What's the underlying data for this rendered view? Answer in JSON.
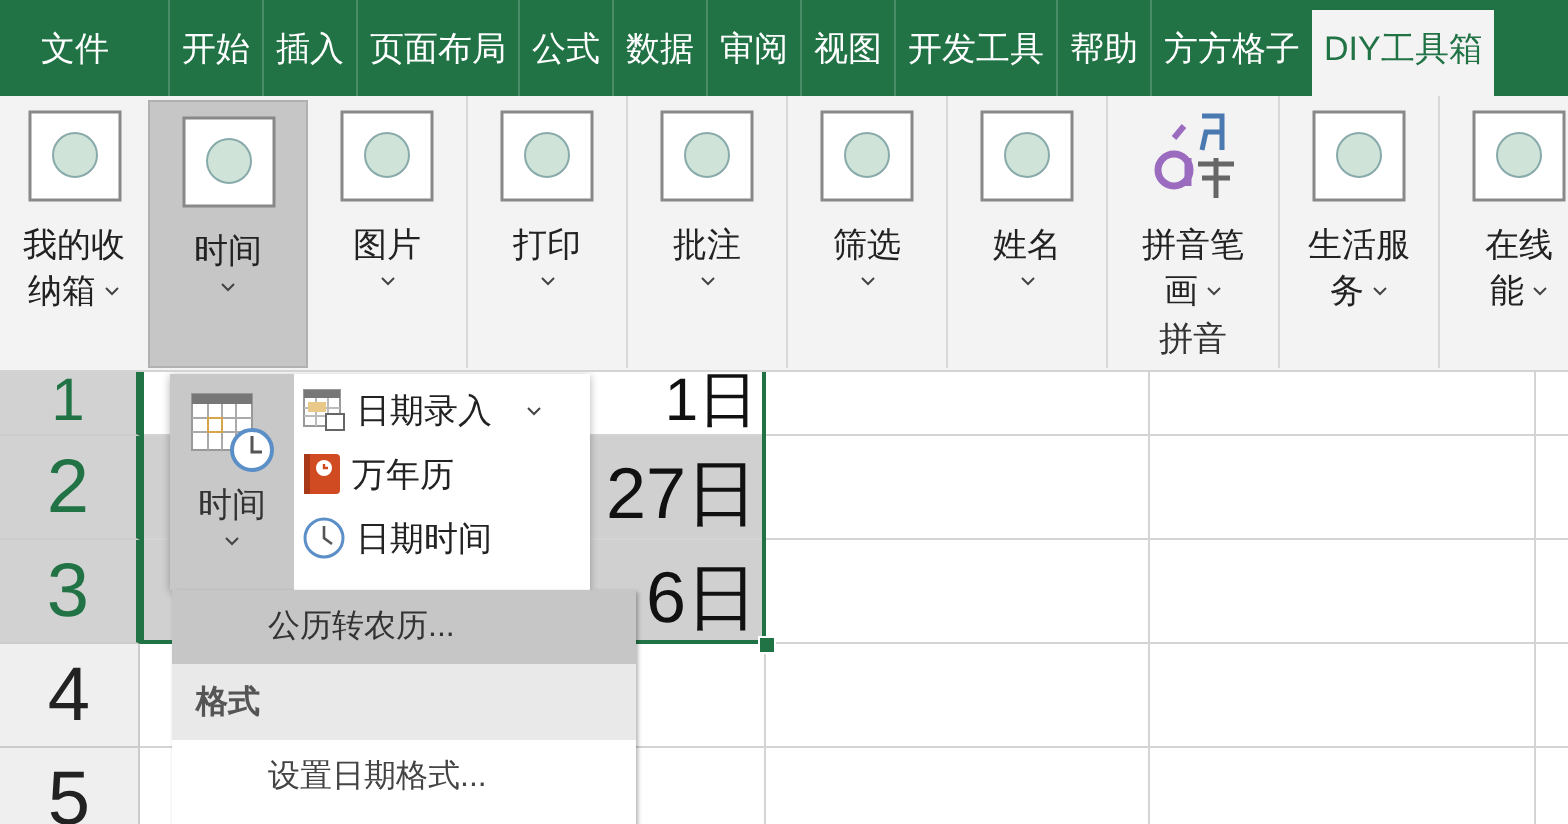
{
  "tabs": [
    {
      "label": "文件",
      "selected": false
    },
    {
      "label": "开始",
      "selected": false
    },
    {
      "label": "插入",
      "selected": false
    },
    {
      "label": "页面布局",
      "selected": false
    },
    {
      "label": "公式",
      "selected": false
    },
    {
      "label": "数据",
      "selected": false
    },
    {
      "label": "审阅",
      "selected": false
    },
    {
      "label": "视图",
      "selected": false
    },
    {
      "label": "开发工具",
      "selected": false
    },
    {
      "label": "帮助",
      "selected": false
    },
    {
      "label": "方方格子",
      "selected": false
    },
    {
      "label": "DIY工具箱",
      "selected": true
    }
  ],
  "ribbon": {
    "buttons": [
      {
        "kind": "box",
        "lines": [
          "我的收",
          "纳箱"
        ],
        "caret": true,
        "pressed": false
      },
      {
        "kind": "box",
        "lines": [
          "时间"
        ],
        "caret": true,
        "pressed": true
      },
      {
        "kind": "box",
        "lines": [
          "图片"
        ],
        "caret": true,
        "pressed": false
      },
      {
        "kind": "box",
        "lines": [
          "打印"
        ],
        "caret": true,
        "pressed": false
      },
      {
        "kind": "box",
        "lines": [
          "批注"
        ],
        "caret": true,
        "pressed": false
      },
      {
        "kind": "box",
        "lines": [
          "筛选"
        ],
        "caret": true,
        "pressed": false
      },
      {
        "kind": "box",
        "lines": [
          "姓名"
        ],
        "caret": true,
        "pressed": false
      },
      {
        "kind": "pinyin",
        "lines": [
          "拼音笔",
          "画"
        ],
        "caret": true,
        "pressed": false,
        "group_label": "拼音"
      },
      {
        "kind": "box",
        "lines": [
          "生活服",
          "务"
        ],
        "caret": true,
        "pressed": false
      },
      {
        "kind": "box",
        "lines": [
          "在线",
          "能"
        ],
        "caret": true,
        "pressed": false
      }
    ]
  },
  "sheet": {
    "rows": [
      {
        "header": "1",
        "selected": true,
        "cell": "1日"
      },
      {
        "header": "2",
        "selected": true,
        "cell": "27日"
      },
      {
        "header": "3",
        "selected": true,
        "cell": "6日"
      },
      {
        "header": "4",
        "selected": false
      },
      {
        "header": "5",
        "selected": false
      }
    ]
  },
  "time_popup": {
    "button": {
      "label": "时间",
      "pressed": true,
      "caret": true
    },
    "items": [
      {
        "kind": "calendar",
        "label": "日期录入",
        "caret": true
      },
      {
        "kind": "almanac",
        "label": "万年历",
        "caret": false
      },
      {
        "kind": "clock",
        "label": "日期时间",
        "caret": false
      }
    ]
  },
  "menu": [
    {
      "kind": "item",
      "label": "公历转农历...",
      "selected": true
    },
    {
      "kind": "header",
      "label": "格式"
    },
    {
      "kind": "item",
      "label": "设置日期格式...",
      "selected": false
    }
  ]
}
